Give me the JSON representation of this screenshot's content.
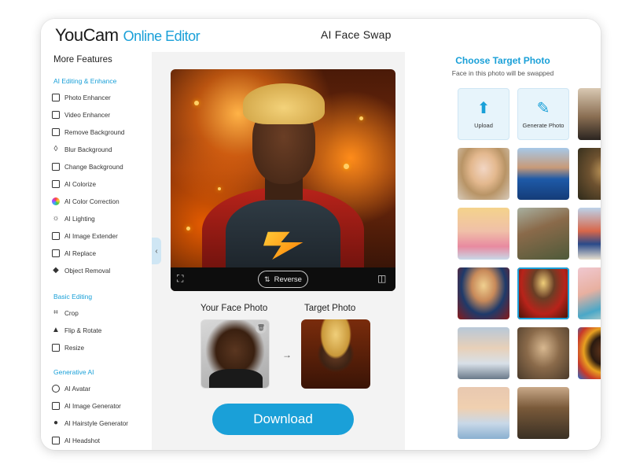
{
  "header": {
    "brand": "YouCam",
    "product": "Online Editor",
    "title": "AI Face Swap"
  },
  "sidebar": {
    "title": "More Features",
    "sections": [
      {
        "label": "AI Editing & Enhance",
        "items": [
          {
            "label": "Photo Enhancer",
            "icon": "photo-icon"
          },
          {
            "label": "Video Enhancer",
            "icon": "video-icon"
          },
          {
            "label": "Remove Background",
            "icon": "remove-bg-icon"
          },
          {
            "label": "Blur Background",
            "icon": "drop-icon"
          },
          {
            "label": "Change Background",
            "icon": "image-icon"
          },
          {
            "label": "AI Colorize",
            "icon": "colorize-icon"
          },
          {
            "label": "AI Color Correction",
            "icon": "color-wheel-icon"
          },
          {
            "label": "AI Lighting",
            "icon": "sun-icon"
          },
          {
            "label": "AI Image Extender",
            "icon": "extend-icon"
          },
          {
            "label": "AI Replace",
            "icon": "replace-icon"
          },
          {
            "label": "Object Removal",
            "icon": "eraser-icon"
          }
        ]
      },
      {
        "label": "Basic Editing",
        "items": [
          {
            "label": "Crop",
            "icon": "crop-icon"
          },
          {
            "label": "Flip & Rotate",
            "icon": "flip-icon"
          },
          {
            "label": "Resize",
            "icon": "resize-icon"
          }
        ]
      },
      {
        "label": "Generative AI",
        "items": [
          {
            "label": "AI Avatar",
            "icon": "avatar-icon"
          },
          {
            "label": "AI Image Generator",
            "icon": "ai-image-icon"
          },
          {
            "label": "AI Hairstyle Generator",
            "icon": "hair-icon"
          },
          {
            "label": "AI Headshot",
            "icon": "headshot-icon"
          }
        ]
      }
    ]
  },
  "editor": {
    "reverse_label": "Reverse",
    "your_face_label": "Your Face Photo",
    "target_label": "Target Photo",
    "download_label": "Download"
  },
  "target_panel": {
    "title": "Choose Target Photo",
    "subtitle": "Face in this photo will be swapped",
    "upload_label": "Upload",
    "generate_label": "Generate Photo",
    "selected_index": 9,
    "accent": "#1aa0d8"
  }
}
